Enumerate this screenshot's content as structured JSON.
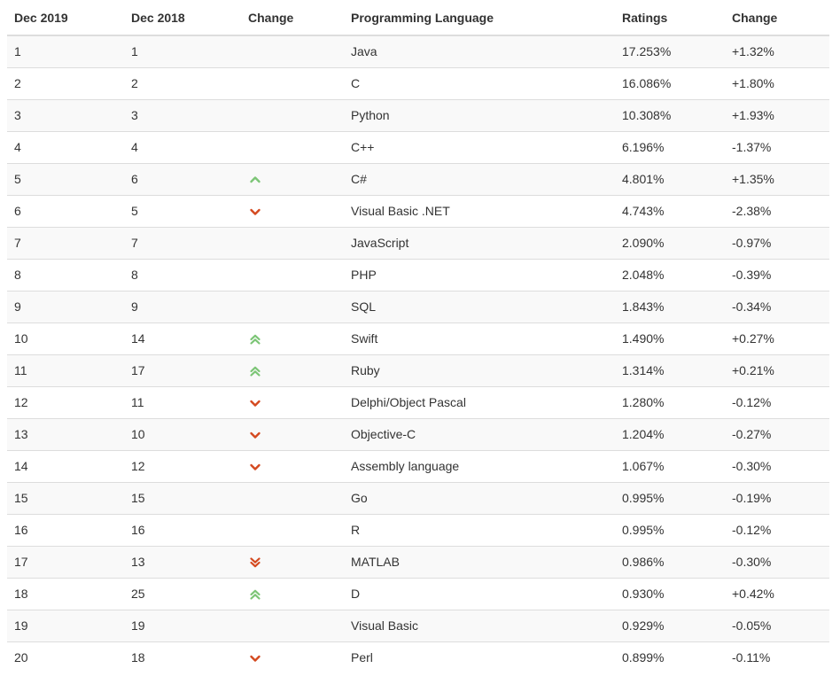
{
  "table": {
    "headers": [
      "Dec 2019",
      "Dec 2018",
      "Change",
      "Programming Language",
      "Ratings",
      "Change"
    ],
    "colors": {
      "up": "#7cc576",
      "down": "#d4491f"
    },
    "rows": [
      {
        "rank2019": "1",
        "rank2018": "1",
        "trend": "none",
        "language": "Java",
        "rating": "17.253%",
        "change": "+1.32%"
      },
      {
        "rank2019": "2",
        "rank2018": "2",
        "trend": "none",
        "language": "C",
        "rating": "16.086%",
        "change": "+1.80%"
      },
      {
        "rank2019": "3",
        "rank2018": "3",
        "trend": "none",
        "language": "Python",
        "rating": "10.308%",
        "change": "+1.93%"
      },
      {
        "rank2019": "4",
        "rank2018": "4",
        "trend": "none",
        "language": "C++",
        "rating": "6.196%",
        "change": "-1.37%"
      },
      {
        "rank2019": "5",
        "rank2018": "6",
        "trend": "up",
        "language": "C#",
        "rating": "4.801%",
        "change": "+1.35%"
      },
      {
        "rank2019": "6",
        "rank2018": "5",
        "trend": "down",
        "language": "Visual Basic .NET",
        "rating": "4.743%",
        "change": "-2.38%"
      },
      {
        "rank2019": "7",
        "rank2018": "7",
        "trend": "none",
        "language": "JavaScript",
        "rating": "2.090%",
        "change": "-0.97%"
      },
      {
        "rank2019": "8",
        "rank2018": "8",
        "trend": "none",
        "language": "PHP",
        "rating": "2.048%",
        "change": "-0.39%"
      },
      {
        "rank2019": "9",
        "rank2018": "9",
        "trend": "none",
        "language": "SQL",
        "rating": "1.843%",
        "change": "-0.34%"
      },
      {
        "rank2019": "10",
        "rank2018": "14",
        "trend": "double-up",
        "language": "Swift",
        "rating": "1.490%",
        "change": "+0.27%"
      },
      {
        "rank2019": "11",
        "rank2018": "17",
        "trend": "double-up",
        "language": "Ruby",
        "rating": "1.314%",
        "change": "+0.21%"
      },
      {
        "rank2019": "12",
        "rank2018": "11",
        "trend": "down",
        "language": "Delphi/Object Pascal",
        "rating": "1.280%",
        "change": "-0.12%"
      },
      {
        "rank2019": "13",
        "rank2018": "10",
        "trend": "down",
        "language": "Objective-C",
        "rating": "1.204%",
        "change": "-0.27%"
      },
      {
        "rank2019": "14",
        "rank2018": "12",
        "trend": "down",
        "language": "Assembly language",
        "rating": "1.067%",
        "change": "-0.30%"
      },
      {
        "rank2019": "15",
        "rank2018": "15",
        "trend": "none",
        "language": "Go",
        "rating": "0.995%",
        "change": "-0.19%"
      },
      {
        "rank2019": "16",
        "rank2018": "16",
        "trend": "none",
        "language": "R",
        "rating": "0.995%",
        "change": "-0.12%"
      },
      {
        "rank2019": "17",
        "rank2018": "13",
        "trend": "double-down",
        "language": "MATLAB",
        "rating": "0.986%",
        "change": "-0.30%"
      },
      {
        "rank2019": "18",
        "rank2018": "25",
        "trend": "double-up",
        "language": "D",
        "rating": "0.930%",
        "change": "+0.42%"
      },
      {
        "rank2019": "19",
        "rank2018": "19",
        "trend": "none",
        "language": "Visual Basic",
        "rating": "0.929%",
        "change": "-0.05%"
      },
      {
        "rank2019": "20",
        "rank2018": "18",
        "trend": "down",
        "language": "Perl",
        "rating": "0.899%",
        "change": "-0.11%"
      }
    ]
  }
}
